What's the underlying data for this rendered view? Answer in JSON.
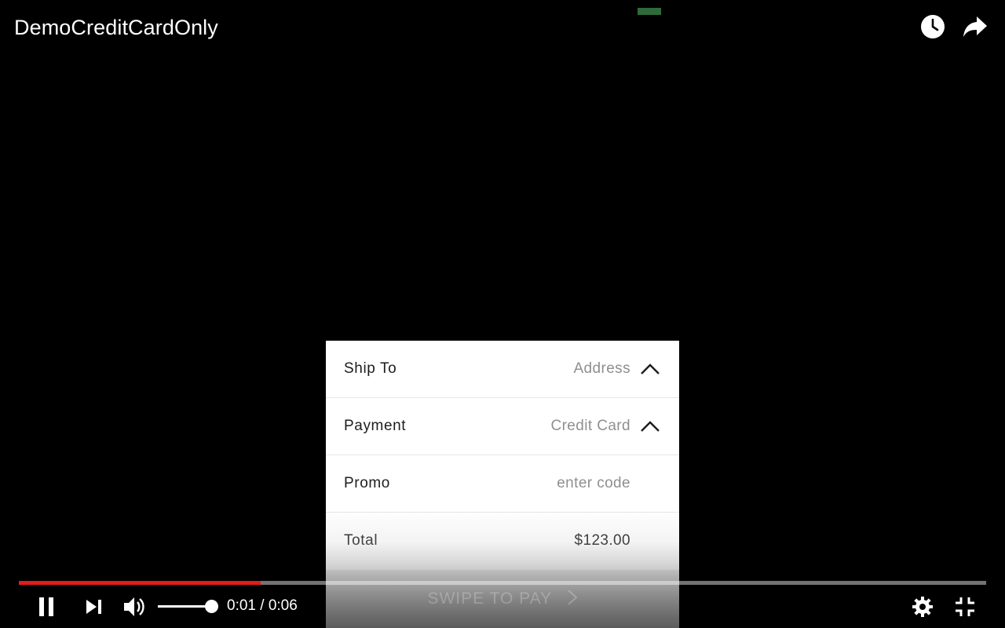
{
  "video": {
    "title": "DemoCreditCardOnly"
  },
  "top_bar": {
    "icons": [
      "clock-icon",
      "share-arrow-icon"
    ]
  },
  "checkout": {
    "rows": [
      {
        "label": "Ship To",
        "value": "Address",
        "expanded": true
      },
      {
        "label": "Payment",
        "value": "Credit Card",
        "expanded": true
      },
      {
        "label": "Promo",
        "value": "enter code"
      },
      {
        "label": "Total",
        "value": "$123.00"
      }
    ],
    "swipe_label": "SWIPE TO PAY"
  },
  "player": {
    "current_time": "0:01",
    "separator": "/",
    "duration": "0:06",
    "progress_fraction": 0.25,
    "volume_fraction": 1.0,
    "state": "playing",
    "colors": {
      "progress": "#e21b1b",
      "background": "#000000"
    }
  }
}
